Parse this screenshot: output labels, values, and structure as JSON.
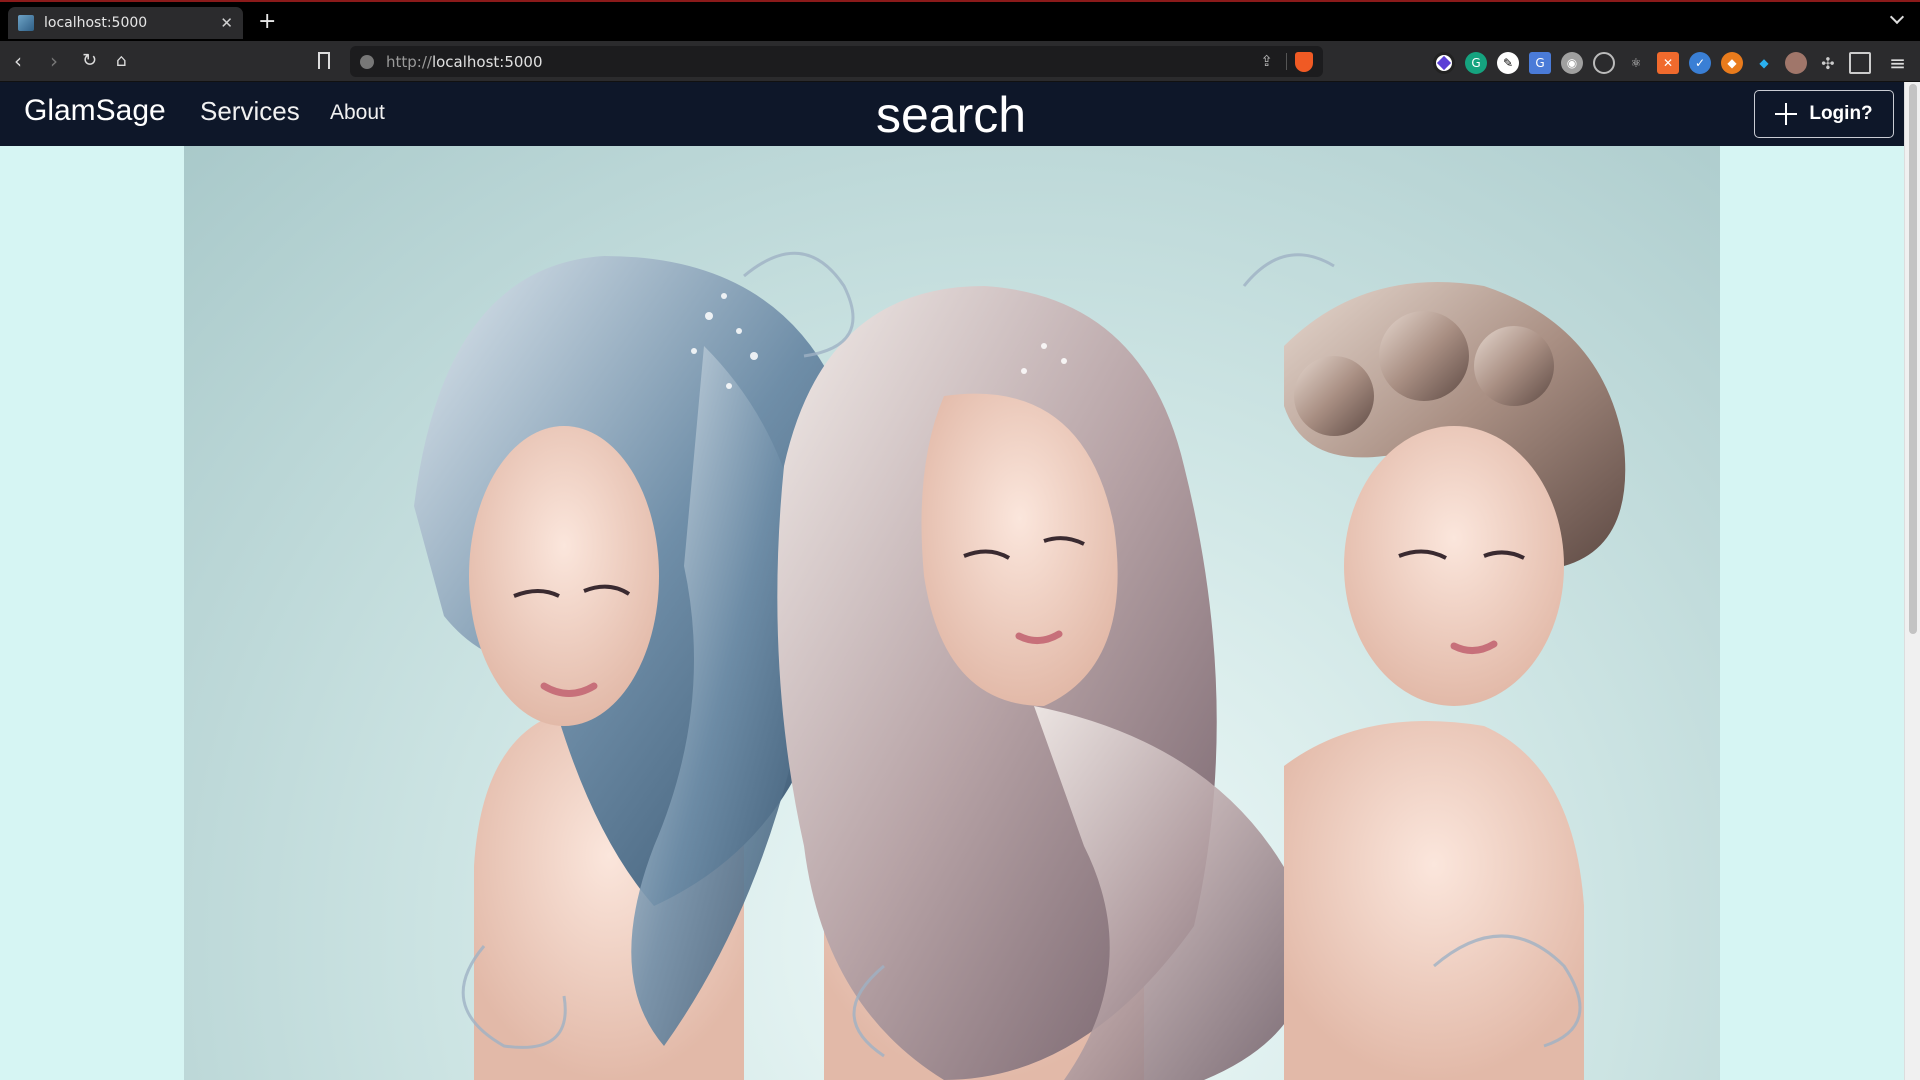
{
  "browser": {
    "tab_title": "localhost:5000",
    "url_prefix": "http://",
    "url_host": "localhost:5000",
    "new_tab": "+"
  },
  "navbar": {
    "brand": "GlamSage",
    "links": [
      "Services",
      "About"
    ],
    "search_label": "search",
    "login_label": "Login?"
  },
  "hero": {
    "description_icon": "three-women-hair-illustration"
  },
  "colors": {
    "navbar_bg": "#0e1729",
    "page_bg": "#d6f5f3",
    "hero_bg": "#bcd9d9"
  }
}
